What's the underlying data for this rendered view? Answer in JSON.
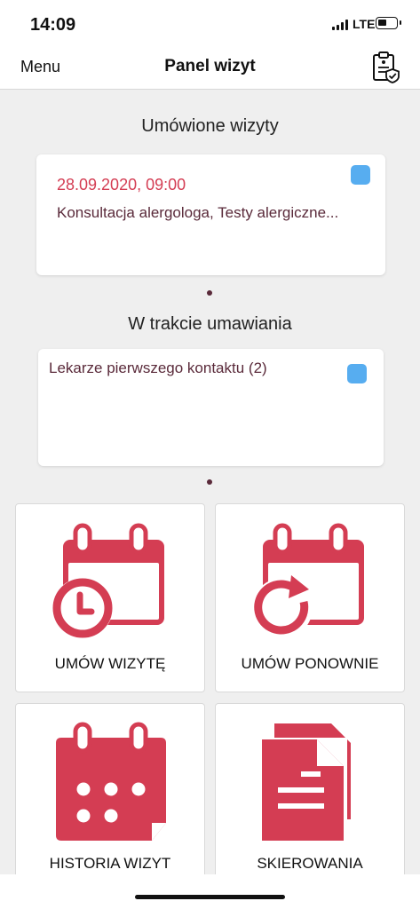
{
  "status_bar": {
    "time": "14:09",
    "network": "LTE"
  },
  "nav": {
    "menu_label": "Menu",
    "title": "Panel wizyt",
    "right_icon": "clipboard-shield-icon"
  },
  "scheduled": {
    "title": "Umówione wizyty",
    "card": {
      "date": "28.09.2020, 09:00",
      "description": "Konsultacja alergologa, Testy alergiczne..."
    }
  },
  "in_progress": {
    "title": "W trakcie umawiania",
    "card": {
      "label": "Lekarze pierwszego kontaktu (2)"
    }
  },
  "tiles": [
    {
      "label": "UMÓW WIZYTĘ",
      "icon": "calendar-clock-icon"
    },
    {
      "label": "UMÓW PONOWNIE",
      "icon": "calendar-refresh-icon"
    },
    {
      "label": "HISTORIA WIZYT",
      "icon": "calendar-history-icon"
    },
    {
      "label": "SKIEROWANIA",
      "icon": "documents-icon"
    }
  ],
  "colors": {
    "accent": "#d43d53",
    "badge": "#57adf0",
    "background": "#efefef"
  }
}
